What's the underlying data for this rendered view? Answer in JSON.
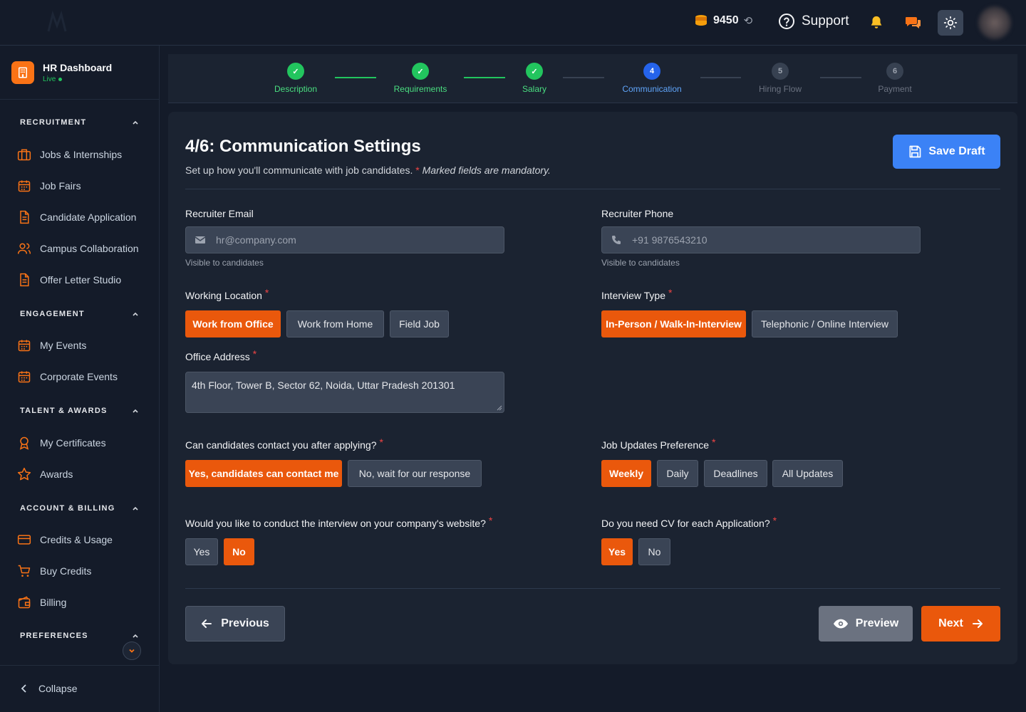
{
  "topbar": {
    "credits": "9450",
    "refresh_glyph": "⟲",
    "support_label": "Support"
  },
  "sidebar": {
    "brand_title": "HR Dashboard",
    "brand_status": "Live",
    "sections": [
      {
        "title": "RECRUITMENT",
        "items": [
          {
            "label": "Jobs & Internships",
            "icon": "briefcase-icon"
          },
          {
            "label": "Job Fairs",
            "icon": "calendar-icon"
          },
          {
            "label": "Candidate Application",
            "icon": "document-icon"
          },
          {
            "label": "Campus Collaboration",
            "icon": "users-icon"
          },
          {
            "label": "Offer Letter Studio",
            "icon": "document-icon"
          }
        ]
      },
      {
        "title": "ENGAGEMENT",
        "items": [
          {
            "label": "My Events",
            "icon": "calendar-icon"
          },
          {
            "label": "Corporate Events",
            "icon": "calendar-icon"
          }
        ]
      },
      {
        "title": "TALENT & AWARDS",
        "items": [
          {
            "label": "My Certificates",
            "icon": "ribbon-icon"
          },
          {
            "label": "Awards",
            "icon": "star-icon"
          }
        ]
      },
      {
        "title": "ACCOUNT & BILLING",
        "items": [
          {
            "label": "Credits & Usage",
            "icon": "card-icon"
          },
          {
            "label": "Buy Credits",
            "icon": "cart-icon"
          },
          {
            "label": "Billing",
            "icon": "wallet-icon"
          }
        ]
      },
      {
        "title": "PREFERENCES",
        "items": []
      }
    ],
    "collapse_label": "Collapse"
  },
  "stepper": {
    "steps": [
      {
        "label": "Description",
        "marker": "✓",
        "state": "done"
      },
      {
        "label": "Requirements",
        "marker": "✓",
        "state": "done"
      },
      {
        "label": "Salary",
        "marker": "✓",
        "state": "done"
      },
      {
        "label": "Communication",
        "marker": "4",
        "state": "current"
      },
      {
        "label": "Hiring Flow",
        "marker": "5",
        "state": "todo"
      },
      {
        "label": "Payment",
        "marker": "6",
        "state": "todo"
      }
    ]
  },
  "form": {
    "title": "4/6: Communication Settings",
    "subtitle": "Set up how you'll communicate with job candidates.",
    "required_mark": "*",
    "mandatory_note": "Marked fields are mandatory.",
    "save_draft_label": "Save Draft",
    "recruiter_email": {
      "label": "Recruiter Email",
      "placeholder": "hr@company.com",
      "hint": "Visible to candidates"
    },
    "recruiter_phone": {
      "label": "Recruiter Phone",
      "placeholder": "+91 9876543210",
      "hint": "Visible to candidates"
    },
    "working_location": {
      "label": "Working Location",
      "options": [
        "Work from Office",
        "Work from Home",
        "Field Job"
      ],
      "selected": "Work from Office"
    },
    "interview_type": {
      "label": "Interview Type",
      "options": [
        "In-Person / Walk-In-Interview",
        "Telephonic / Online Interview"
      ],
      "selected": "In-Person / Walk-In-Interview"
    },
    "office_address": {
      "label": "Office Address",
      "value": "4th Floor, Tower B, Sector 62, Noida, Uttar Pradesh 201301"
    },
    "candidate_contact": {
      "label": "Can candidates contact you after applying?",
      "options": [
        "Yes, candidates can contact me",
        "No, wait for our response"
      ],
      "selected": "Yes, candidates can contact me"
    },
    "job_updates": {
      "label": "Job Updates Preference",
      "options": [
        "Weekly",
        "Daily",
        "Deadlines",
        "All Updates"
      ],
      "selected": "Weekly"
    },
    "website_interview": {
      "label": "Would you like to conduct the interview on your company's website?",
      "options": [
        "Yes",
        "No"
      ],
      "selected": "No"
    },
    "cv_required": {
      "label": "Do you need CV for each Application?",
      "options": [
        "Yes",
        "No"
      ],
      "selected": "Yes"
    },
    "previous_label": "Previous",
    "preview_label": "Preview",
    "next_label": "Next"
  },
  "colors": {
    "accent_orange": "#ea580c",
    "primary_blue": "#3b82f6",
    "success_green": "#22c55e",
    "background": "#141b29",
    "card": "#1b2331"
  }
}
